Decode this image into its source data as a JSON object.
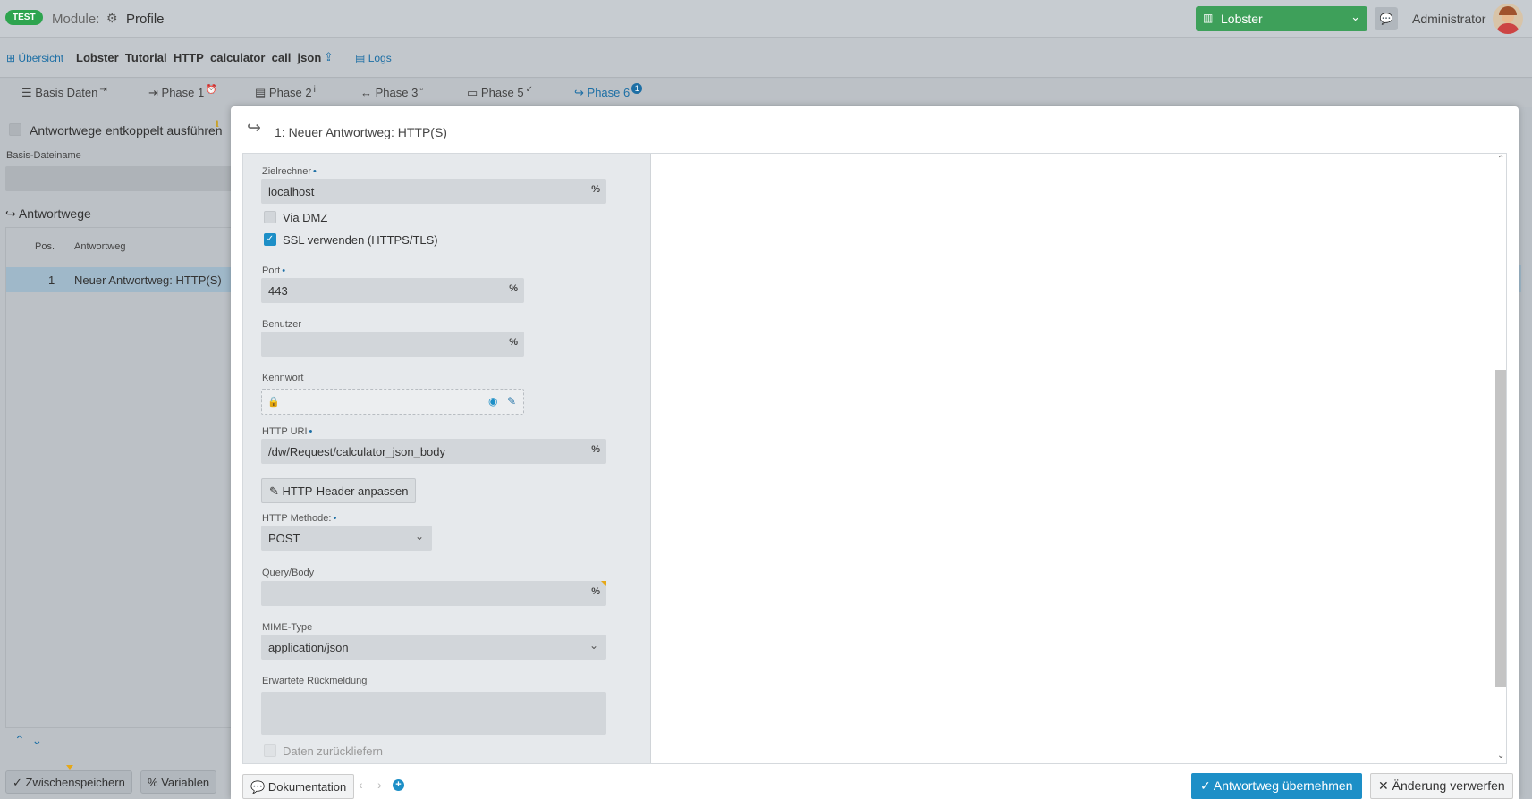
{
  "topbar": {
    "env_badge": "TEST",
    "module_label": "Module:",
    "module_icon": "cpu-icon",
    "module_name": "Profile",
    "instance_select": "Lobster",
    "user_name": "Administrator",
    "accent_color": "#3ea05a"
  },
  "subbar": {
    "overview_link": "Übersicht",
    "profile_name": "Lobster_Tutorial_HTTP_calculator_call_json",
    "logs_link": "Logs"
  },
  "tabs": [
    {
      "label": "Basis Daten",
      "icon": "list-icon"
    },
    {
      "label": "Phase 1",
      "icon": "sign-in-icon"
    },
    {
      "label": "Phase 2",
      "icon": "file-icon"
    },
    {
      "label": "Phase 3",
      "icon": "arrows-h-icon"
    },
    {
      "label": "Phase 5",
      "icon": "server-icon"
    },
    {
      "label": "Phase 6",
      "icon": "share-icon",
      "badge": "1"
    }
  ],
  "left_panel": {
    "decoupled_label": "Antwortwege entkoppelt ausführen",
    "basis_dateiname_label": "Basis-Dateiname",
    "heading": "Antwortwege",
    "col_pos": "Pos.",
    "col_antwortweg": "Antwortweg",
    "rows": [
      {
        "pos": "1",
        "name": "Neuer Antwortweg: HTTP(S)"
      }
    ],
    "save_button": "Zwischenspeichern",
    "variables_button": "Variablen"
  },
  "modal": {
    "title": "1: Neuer Antwortweg: HTTP(S)",
    "form": {
      "zielrechner_label": "Zielrechner",
      "zielrechner_value": "localhost",
      "via_dmz_label": "Via DMZ",
      "via_dmz_checked": false,
      "ssl_label": "SSL verwenden (HTTPS/TLS)",
      "ssl_checked": true,
      "port_label": "Port",
      "port_value": "443",
      "benutzer_label": "Benutzer",
      "benutzer_value": "",
      "kennwort_label": "Kennwort",
      "http_uri_label": "HTTP URI",
      "http_uri_value": "/dw/Request/calculator_json_body",
      "header_button": "HTTP-Header anpassen",
      "method_label": "HTTP Methode:",
      "method_value": "POST",
      "query_label": "Query/Body",
      "query_value": "",
      "mime_label": "MIME-Type",
      "mime_value": "application/json",
      "response_label": "Erwartete Rückmeldung",
      "return_data_label": "Daten zurückliefern",
      "required_marker": "•"
    },
    "footer": {
      "doc_button": "Dokumentation",
      "apply_button": "Antwortweg übernehmen",
      "discard_button": "Änderung verwerfen"
    }
  }
}
